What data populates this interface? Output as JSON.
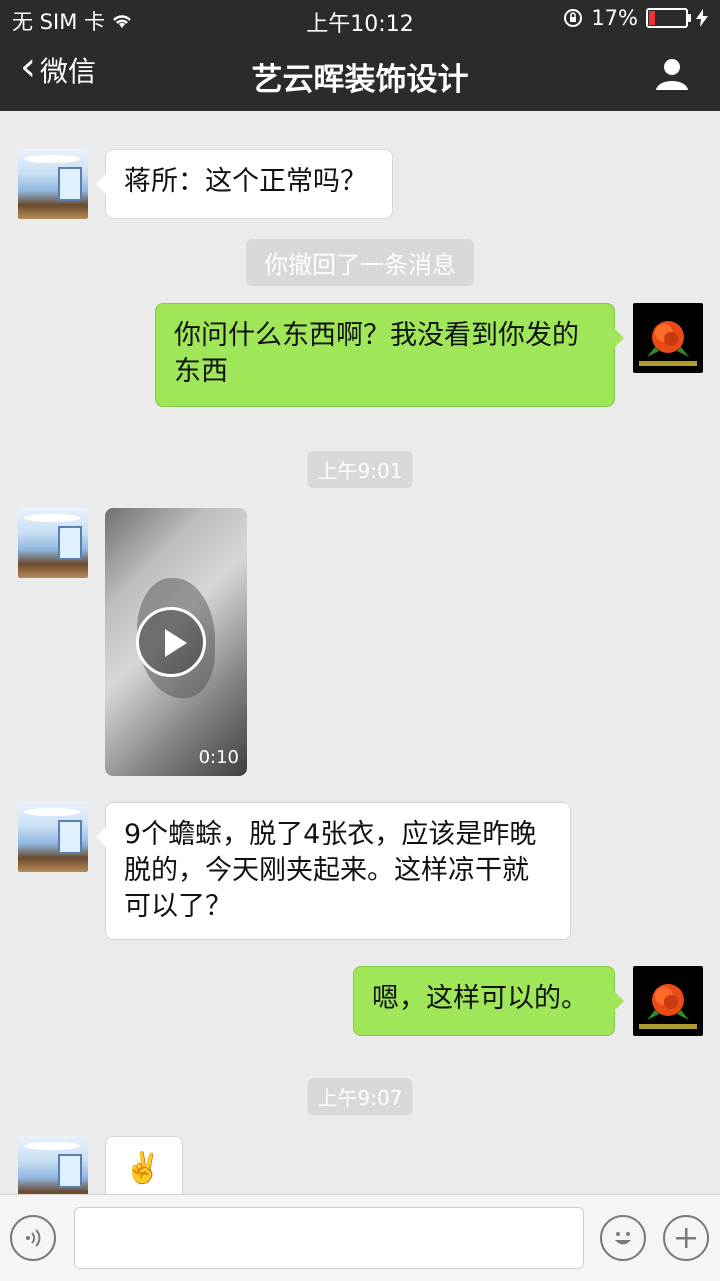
{
  "status_bar": {
    "carrier": "无 SIM 卡",
    "time": "上午10:12",
    "battery": "17%"
  },
  "nav": {
    "back_label": "微信",
    "title": "艺云晖装饰设计"
  },
  "messages": {
    "m1_text": "蒋所：这个正常吗？",
    "recall_notice": "你撤回了一条消息",
    "m2_text": "你问什么东西啊？我没看到你发的东西",
    "time_chip_1": "上午9:01",
    "video_duration": "0:10",
    "m3_text": "9个蟾蜍，脱了4张衣，应该是昨晚脱的，今天刚夹起来。这样凉干就可以了？",
    "m4_text": "嗯，这样可以的。",
    "time_chip_2": "上午9:07",
    "m5_emoji": "✌️"
  },
  "colors": {
    "sent_bubble": "#9fe659",
    "received_bubble": "#ffffff",
    "chat_background": "#ebebeb",
    "top_bar": "#2b2b2b",
    "battery_low": "#ee3333"
  },
  "icons": {
    "back": "chevron-left-icon",
    "profile": "person-icon",
    "voice": "voice-icon",
    "emoji": "smiley-icon",
    "more": "plus-icon",
    "wifi": "wifi-icon",
    "lock": "rotation-lock-icon",
    "charging": "bolt-icon"
  }
}
